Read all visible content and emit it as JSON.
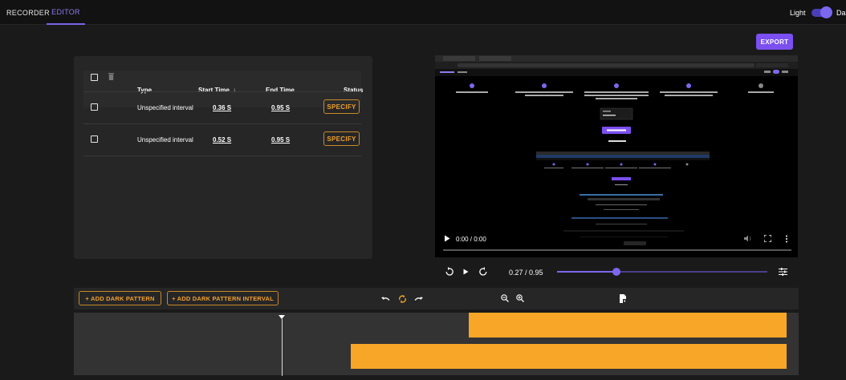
{
  "nav": {
    "tabs": [
      {
        "label": "RECORDER"
      },
      {
        "label": "EDITOR"
      }
    ],
    "theme_light": "Light",
    "theme_dark": "Dark"
  },
  "toolbar": {
    "export_label": "EXPORT"
  },
  "table": {
    "columns": {
      "type": "Type",
      "start": "Start Time",
      "end": "End Time",
      "status": "Status"
    },
    "sort_indicator": "↓",
    "rows": [
      {
        "type": "Unspecified interval",
        "start": "0.36 S",
        "end": "0.95 S",
        "action": "SPECIFY"
      },
      {
        "type": "Unspecified interval",
        "start": "0.52 S",
        "end": "0.95 S",
        "action": "SPECIFY"
      }
    ]
  },
  "video": {
    "time": "0:00 / 0:00",
    "progress": 0
  },
  "playback": {
    "time": "0.27 / 0.95",
    "position": 0.27,
    "duration": 0.95
  },
  "timeline": {
    "add_pattern_label": "+ ADD DARK PATTERN",
    "add_interval_label": "+ ADD DARK PATTERN INTERVAL",
    "segments": [
      {
        "start": 0.52,
        "end": 0.95
      },
      {
        "start": 0.36,
        "end": 0.95
      }
    ]
  },
  "icons": {
    "trash": "trash-icon",
    "undo": "undo-icon",
    "sync": "sync-icon",
    "redo": "redo-icon",
    "zoom_out": "zoom-out-icon",
    "zoom_in": "zoom-in-icon",
    "file": "file-icon"
  },
  "colors": {
    "accent": "#7b68ee",
    "orange": "#f7a627"
  }
}
